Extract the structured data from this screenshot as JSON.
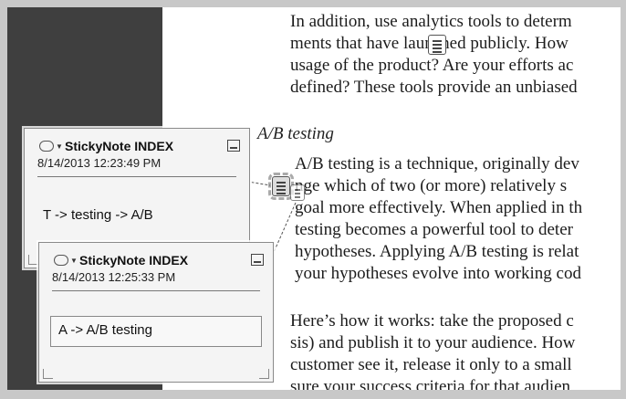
{
  "document": {
    "paragraph1": [
      "In addition, use analytics tools to determ",
      "ments that have launched publicly. How",
      "usage of the product? Are your efforts ac",
      "defined? These tools provide an unbiased"
    ],
    "heading": "A/B testing",
    "paragraph2": [
      "A/B testing is a technique, originally dev",
      "nge which of two (or more) relatively s",
      "goal more effectively. When applied in th",
      "testing becomes a powerful tool to deter",
      "hypotheses. Applying A/B testing is relat",
      "your hypotheses evolve into working cod"
    ],
    "paragraph3": [
      "Here’s how it works: take the proposed c",
      "sis) and publish it to your audience. How",
      "customer see it, release it only to a small",
      "sure your success criteria for that audien"
    ]
  },
  "notes": [
    {
      "title": "StickyNote INDEX",
      "date": "8/14/2013 12:23:49 PM",
      "text": "T -> testing -> A/B"
    },
    {
      "title": "StickyNote INDEX",
      "date": "8/14/2013 12:25:33 PM",
      "text": "A -> A/B testing"
    }
  ]
}
